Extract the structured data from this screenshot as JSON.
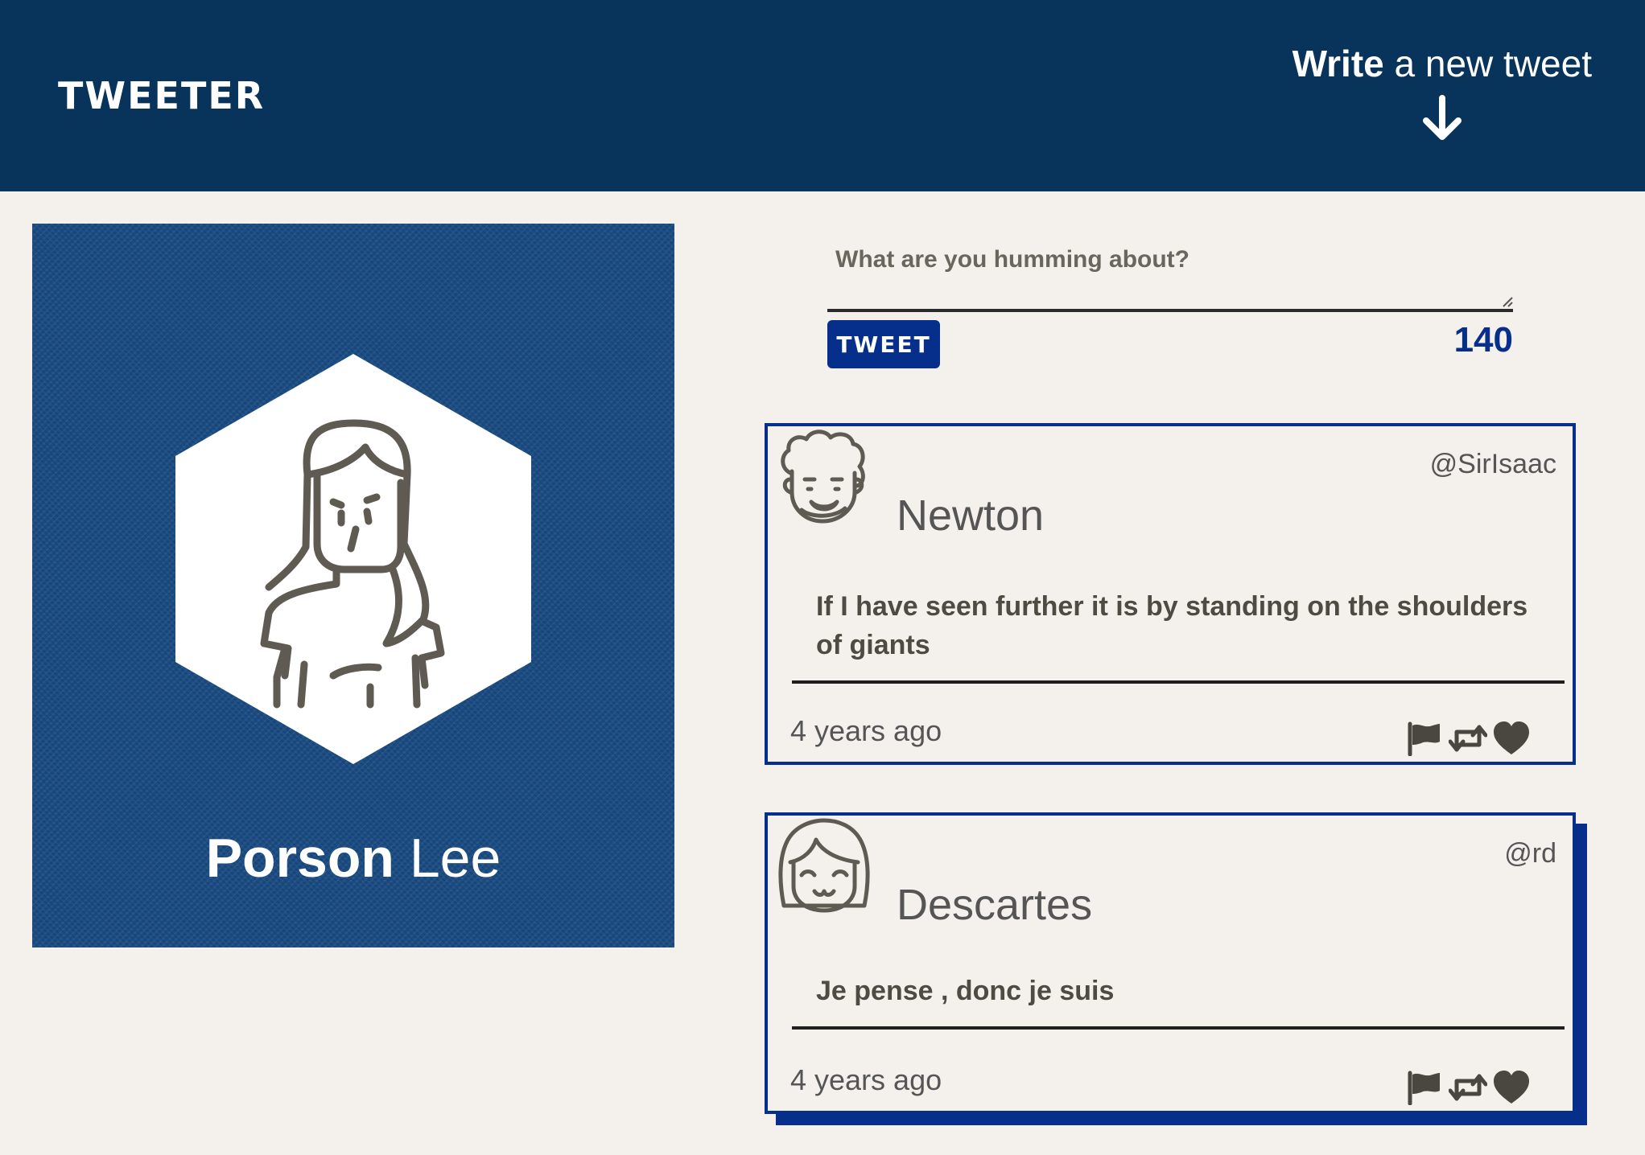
{
  "header": {
    "brand": "TWEETER",
    "compose_toggle": {
      "bold": "Write",
      "rest": " a new tweet",
      "icon": "arrow-down-icon"
    }
  },
  "profile": {
    "first_name": "Porson",
    "last_name": " Lee",
    "avatar_icon": "woman-avatar-icon"
  },
  "composer": {
    "placeholder": "What are you humming about?",
    "value": "",
    "button_label": "TWEET",
    "counter": "140"
  },
  "tweets": [
    {
      "name": "Newton",
      "handle": "@SirIsaac",
      "content": "If I have seen further it is by standing on the shoulders of giants",
      "time": "4 years ago",
      "avatar_icon": "curly-hair-avatar-icon"
    },
    {
      "name": "Descartes",
      "handle": "@rd",
      "content": "Je pense , donc je suis",
      "time": "4 years ago",
      "avatar_icon": "bob-hair-avatar-icon"
    }
  ],
  "tweet_actions": [
    "flag-icon",
    "retweet-icon",
    "heart-icon"
  ],
  "colors": {
    "header_bg": "#08335a",
    "accent": "#062f8c",
    "page_bg": "#f4f1ed",
    "profile_bg": "#1c4e86",
    "text": "#545149"
  }
}
